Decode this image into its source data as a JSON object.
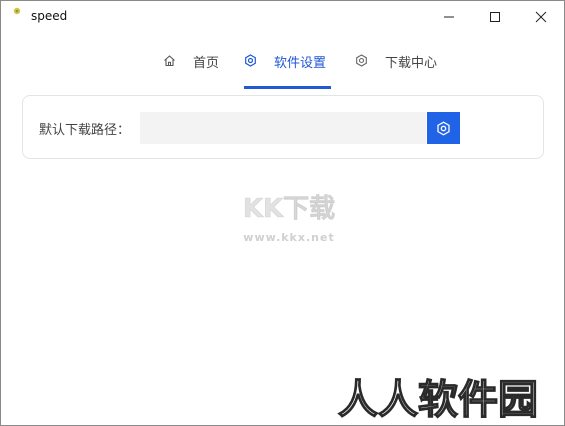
{
  "window": {
    "title": "speed"
  },
  "tabs": [
    {
      "label": "首页",
      "icon": "home-icon",
      "active": false
    },
    {
      "label": "软件设置",
      "icon": "gear-icon",
      "active": true
    },
    {
      "label": "下载中心",
      "icon": "gear-icon",
      "active": false
    }
  ],
  "settings": {
    "download_path_label": "默认下载路径：",
    "download_path_value": ""
  },
  "watermarks": {
    "kk_logo": "KK下载",
    "kk_url": "www.kkx.net",
    "rr_logo": "人人软件园"
  },
  "colors": {
    "accent": "#2158d4",
    "button": "#2163e6"
  }
}
